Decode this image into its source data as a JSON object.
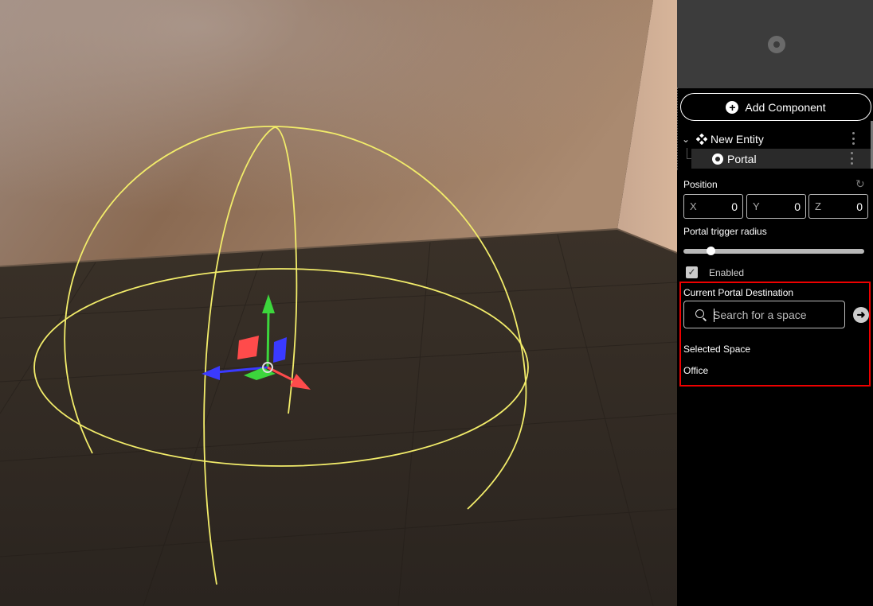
{
  "panel": {
    "add_component_label": "Add Component",
    "tree": {
      "entity_label": "New Entity",
      "child_label": "Portal"
    },
    "position": {
      "label": "Position",
      "x_axis": "X",
      "x_value": "0",
      "y_axis": "Y",
      "y_value": "0",
      "z_axis": "Z",
      "z_value": "0"
    },
    "portal_radius": {
      "label": "Portal trigger radius",
      "value_fraction": 0.15
    },
    "enabled": {
      "label": "Enabled",
      "checked": true
    },
    "destination": {
      "label": "Current Portal Destination",
      "search_placeholder": "Search for a space",
      "selected_label": "Selected Space",
      "selected_value": "Office"
    }
  },
  "icons": [
    "plus-circle-icon",
    "chevron-down-icon",
    "entity-icon",
    "portal-icon",
    "kebab-menu-icon",
    "reset-icon",
    "search-icon",
    "arrow-right-circle-icon",
    "checkbox-icon"
  ],
  "colors": {
    "gizmo_x": "#ff4b4b",
    "gizmo_y": "#3cd63c",
    "gizmo_z": "#3a3aff",
    "sphere_wire": "#f2ec6a",
    "highlight_box": "#e00000"
  }
}
